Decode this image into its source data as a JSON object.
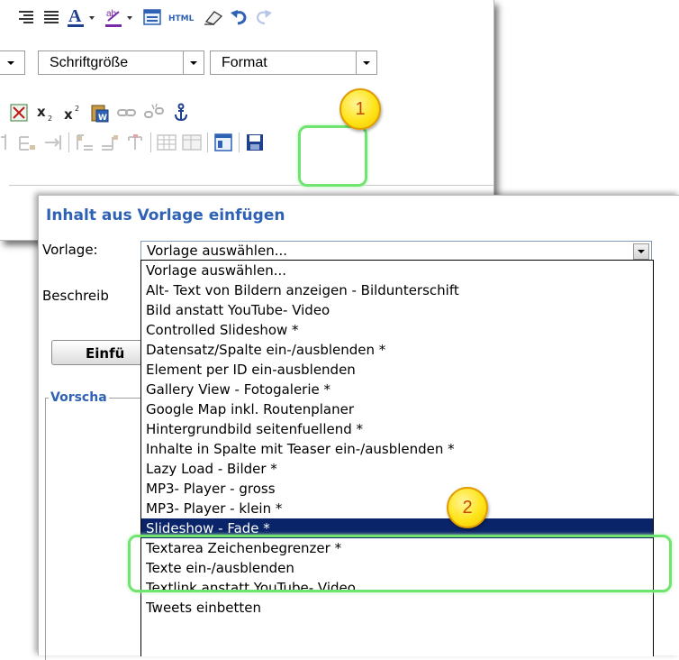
{
  "toolbar": {
    "font_size_select": "Schriftgröße",
    "format_select": "Format",
    "html_label": "HTML"
  },
  "callouts": {
    "one": "1",
    "two": "2"
  },
  "dialog": {
    "title": "Inhalt aus Vorlage einfügen",
    "template_label": "Vorlage:",
    "template_value": "Vorlage auswählen...",
    "description_label": "Beschreib",
    "insert_button": "Einfü",
    "preview_legend": "Vorscha"
  },
  "dropdown": {
    "options": [
      "Vorlage auswählen...",
      "Alt- Text von Bildern anzeigen - Bildunterschift",
      "Bild anstatt YouTube- Video",
      "Controlled Slideshow *",
      "Datensatz/Spalte ein-/ausblenden *",
      "Element per ID ein-ausblenden",
      "Gallery View - Fotogalerie *",
      "Google Map inkl. Routenplaner",
      "Hintergrundbild seitenfuellend *",
      "Inhalte in Spalte mit Teaser ein-/ausblenden *",
      "Lazy Load - Bilder *",
      "MP3- Player - gross",
      "MP3- Player - klein *",
      "Slideshow - Fade *",
      "Textarea Zeichenbegrenzer *",
      "Texte ein-/ausblenden",
      "Textlink anstatt YouTube- Video",
      "Tweets einbetten"
    ],
    "selected": "Slideshow - Fade *"
  },
  "colors": {
    "title_blue": "#2f62b4",
    "selection": "#0a246a",
    "highlight_green": "#6fe46f",
    "callout_yellow": "#ffe419"
  }
}
